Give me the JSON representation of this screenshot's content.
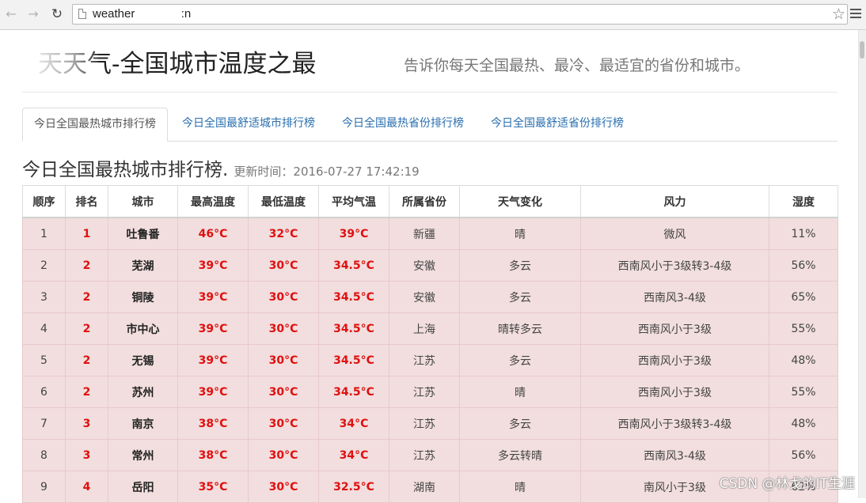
{
  "browser": {
    "url": "weather              :n"
  },
  "header": {
    "title": "天天气-全国城市温度之最",
    "tagline": "告诉你每天全国最热、最冷、最适宜的省份和城市。"
  },
  "tabs": [
    {
      "label": "今日全国最热城市排行榜",
      "active": true
    },
    {
      "label": "今日全国最舒适城市排行榜",
      "active": false
    },
    {
      "label": "今日全国最热省份排行榜",
      "active": false
    },
    {
      "label": "今日全国最舒适省份排行榜",
      "active": false
    }
  ],
  "section": {
    "title": "今日全国最热城市排行榜.",
    "updated": "更新时间：2016-07-27 17:42:19"
  },
  "table": {
    "columns": [
      "顺序",
      "排名",
      "城市",
      "最高温度",
      "最低温度",
      "平均气温",
      "所属省份",
      "天气变化",
      "风力",
      "湿度"
    ],
    "rows": [
      [
        "1",
        "1",
        "吐鲁番",
        "46°C",
        "32°C",
        "39°C",
        "新疆",
        "晴",
        "微风",
        "11%"
      ],
      [
        "2",
        "2",
        "芜湖",
        "39°C",
        "30°C",
        "34.5°C",
        "安徽",
        "多云",
        "西南风小于3级转3-4级",
        "56%"
      ],
      [
        "3",
        "2",
        "铜陵",
        "39°C",
        "30°C",
        "34.5°C",
        "安徽",
        "多云",
        "西南风3-4级",
        "65%"
      ],
      [
        "4",
        "2",
        "市中心",
        "39°C",
        "30°C",
        "34.5°C",
        "上海",
        "晴转多云",
        "西南风小于3级",
        "55%"
      ],
      [
        "5",
        "2",
        "无锡",
        "39°C",
        "30°C",
        "34.5°C",
        "江苏",
        "多云",
        "西南风小于3级",
        "48%"
      ],
      [
        "6",
        "2",
        "苏州",
        "39°C",
        "30°C",
        "34.5°C",
        "江苏",
        "晴",
        "西南风小于3级",
        "55%"
      ],
      [
        "7",
        "3",
        "南京",
        "38°C",
        "30°C",
        "34°C",
        "江苏",
        "多云",
        "西南风小于3级转3-4级",
        "48%"
      ],
      [
        "8",
        "3",
        "常州",
        "38°C",
        "30°C",
        "34°C",
        "江苏",
        "多云转晴",
        "西南风3-4级",
        "56%"
      ],
      [
        "9",
        "4",
        "岳阳",
        "35°C",
        "30°C",
        "32.5°C",
        "湖南",
        "晴",
        "南风小于3级",
        "62%"
      ]
    ]
  },
  "watermark": "CSDN @林戈的IT生涯"
}
